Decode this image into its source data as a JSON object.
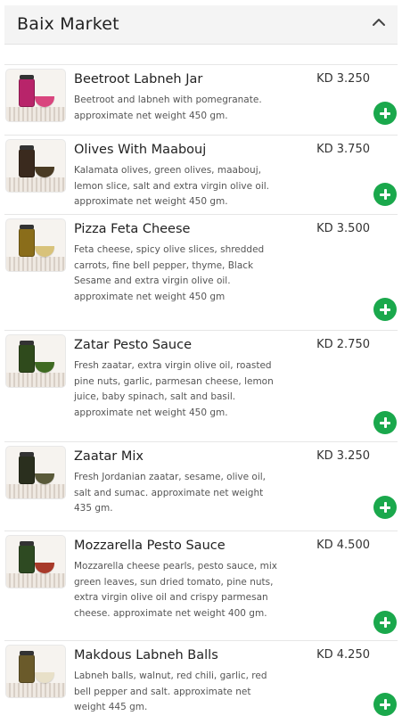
{
  "section": {
    "title": "Baix Market",
    "collapse_icon": "chevron-up-icon"
  },
  "add_icon": "plus-circle-icon",
  "accent_color": "#1aa84c",
  "products": [
    {
      "name": "Beetroot Labneh Jar",
      "price": "KD 3.250",
      "description": "Beetroot and labneh with pomegranate. approximate net weight 450 gm.",
      "jar_color": "#b8246a",
      "bowl_color": "#d9457e"
    },
    {
      "name": "Olives With Maabouj",
      "price": "KD 3.750",
      "description": "Kalamata olives, green olives, maabouj, lemon slice, salt and extra virgin olive oil. approximate net weight 450 gm.",
      "jar_color": "#3a2a1e",
      "bowl_color": "#4a3b24"
    },
    {
      "name": "Pizza Feta Cheese",
      "price": "KD 3.500",
      "description": "Feta cheese, spicy olive slices, shredded carrots, fine bell pepper, thyme, Black Sesame and extra virgin olive oil. approximate net weight 450 gm",
      "jar_color": "#8a6d1a",
      "bowl_color": "#d8c27a"
    },
    {
      "name": "Zatar Pesto Sauce",
      "price": "KD 2.750",
      "description": "Fresh zaatar, extra virgin olive oil, roasted pine nuts, garlic, parmesan cheese, lemon juice, baby spinach, salt and basil. approximate net weight 450 gm.",
      "jar_color": "#2f4a1c",
      "bowl_color": "#3f6a22"
    },
    {
      "name": "Zaatar Mix",
      "price": "KD 3.250",
      "description": "Fresh Jordanian zaatar, sesame, olive oil, salt and sumac. approximate net weight 435 gm.",
      "jar_color": "#2a2f1e",
      "bowl_color": "#5a5a3a"
    },
    {
      "name": "Mozzarella Pesto Sauce",
      "price": "KD 4.500",
      "description": "Mozzarella cheese pearls, pesto sauce, mix green leaves, sun dried tomato, pine nuts, extra virgin olive oil and crispy parmesan cheese. approximate net weight 400 gm.",
      "jar_color": "#2e4a22",
      "bowl_color": "#a83a2a"
    },
    {
      "name": "Makdous Labneh Balls",
      "price": "KD 4.250",
      "description": "Labneh balls, walnut, red chili, garlic, red bell pepper and salt. approximate net weight 445 gm.",
      "jar_color": "#6a5a2a",
      "bowl_color": "#e8e0c8"
    }
  ]
}
